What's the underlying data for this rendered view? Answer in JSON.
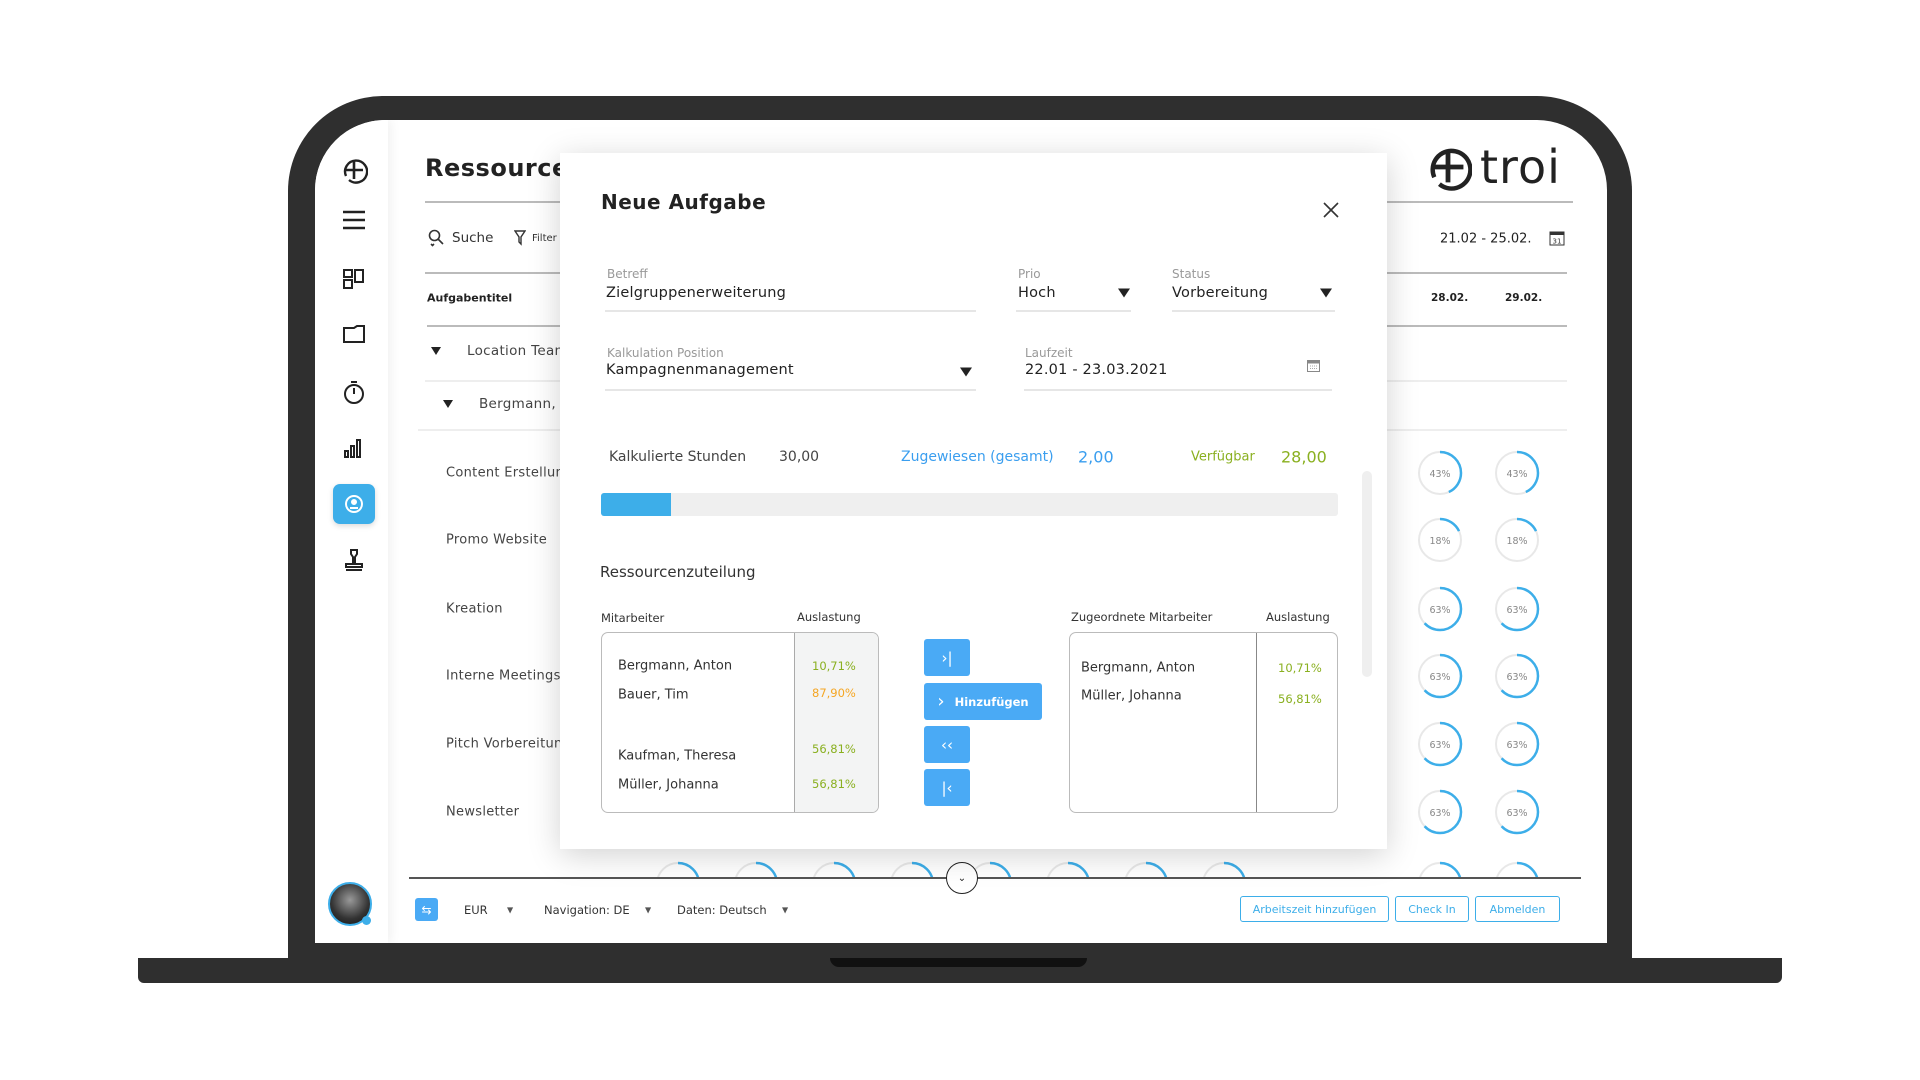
{
  "app": {
    "brand": "troi",
    "page_title": "Ressourcen",
    "accent": "#3daee9",
    "green": "#8ab020",
    "orange": "#f5a623"
  },
  "sidebar": {
    "items": [
      {
        "icon": "troi-plus-logo-icon"
      },
      {
        "icon": "menu-icon"
      },
      {
        "icon": "dashboard-icon"
      },
      {
        "icon": "folder-icon"
      },
      {
        "icon": "stopwatch-icon"
      },
      {
        "icon": "bar-chart-icon"
      },
      {
        "icon": "resource-icon",
        "active": true
      },
      {
        "icon": "stamp-icon"
      }
    ]
  },
  "toolbar": {
    "search": "Suche",
    "filter": "Filter",
    "date_range": "21.02 - 25.02."
  },
  "table": {
    "column_header": "Aufgabentitel",
    "date_columns": [
      "28.02.",
      "29.02."
    ],
    "group": "Location Team",
    "person": "Bergmann, Anton",
    "tasks": [
      {
        "name": "Content Erstellung",
        "loads": [
          43,
          43
        ]
      },
      {
        "name": "Promo Website",
        "loads": [
          18,
          18
        ]
      },
      {
        "name": "Kreation",
        "loads": [
          63,
          63
        ]
      },
      {
        "name": "Interne Meetings",
        "loads": [
          63,
          63
        ]
      },
      {
        "name": "Pitch Vorbereitung",
        "loads": [
          63,
          63
        ]
      },
      {
        "name": "Newsletter",
        "loads": [
          63,
          63
        ]
      }
    ]
  },
  "footer": {
    "currency": "EUR",
    "navigation": "Navigation: DE",
    "data_lang": "Daten: Deutsch",
    "buttons": {
      "add_time": "Arbeitszeit hinzufügen",
      "check_in": "Check In",
      "logout": "Abmelden"
    }
  },
  "modal": {
    "title": "Neue Aufgabe",
    "betreff": {
      "label": "Betreff",
      "value": "Zielgruppenerweiterung"
    },
    "prio": {
      "label": "Prio",
      "value": "Hoch"
    },
    "status": {
      "label": "Status",
      "value": "Vorbereitung"
    },
    "kalkulation": {
      "label": "Kalkulation Position",
      "value": "Kampagnenmanagement"
    },
    "laufzeit": {
      "label": "Laufzeit",
      "value": "22.01 - 23.03.2021"
    },
    "stats": {
      "calc_label": "Kalkulierte Stunden",
      "calc_value": "30,00",
      "assigned_label": "Zugewiesen (gesamt)",
      "assigned_value": "2,00",
      "available_label": "Verfügbar",
      "available_value": "28,00"
    },
    "progress_percent": 9.5,
    "section_title": "Ressourcenzuteilung",
    "left_header": {
      "name": "Mitarbeiter",
      "load": "Auslastung"
    },
    "right_header": {
      "name": "Zugeordnete Mitarbeiter",
      "load": "Auslastung"
    },
    "employees": [
      {
        "name": "Bergmann, Anton",
        "load": "10,71%",
        "color": "#8ab020"
      },
      {
        "name": "Bauer, Tim",
        "load": "87,90%",
        "color": "#f5a623"
      },
      {
        "name": "Kaufman, Theresa",
        "load": "56,81%",
        "color": "#8ab020"
      },
      {
        "name": "Müller, Johanna",
        "load": "56,81%",
        "color": "#8ab020"
      }
    ],
    "assigned": [
      {
        "name": "Bergmann, Anton",
        "load": "10,71%",
        "color": "#8ab020"
      },
      {
        "name": "Müller, Johanna",
        "load": "56,81%",
        "color": "#8ab020"
      }
    ],
    "add_label": "Hinzufügen"
  }
}
